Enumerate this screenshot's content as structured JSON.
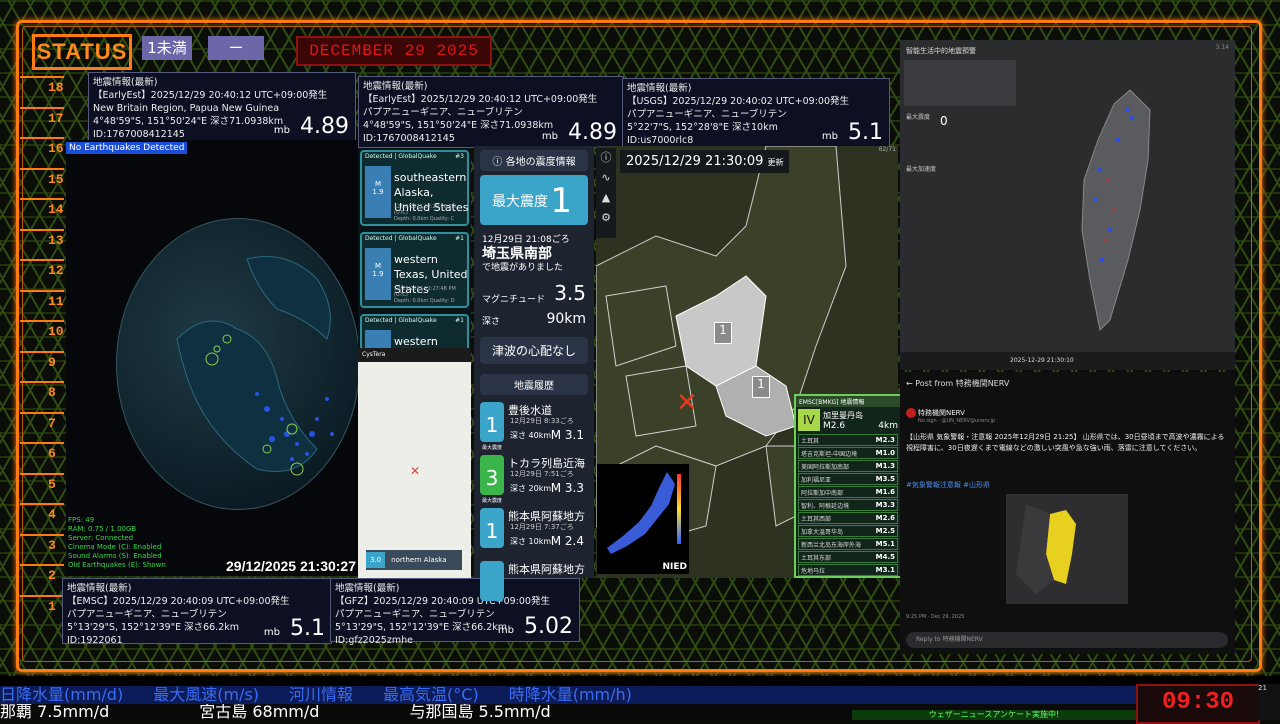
{
  "status_label": "STATUS",
  "pill1": "1未満",
  "pill2": "ー",
  "date_display": "DECEMBER 29  2025",
  "scale_numbers": [
    "18",
    "17",
    "16",
    "15",
    "14",
    "13",
    "12",
    "11",
    "10",
    "9",
    "8",
    "7",
    "6",
    "5",
    "4",
    "3",
    "2",
    "1"
  ],
  "cards": {
    "c1": {
      "title": "地震情報(最新)",
      "line1": "【EarlyEst】2025/12/29  20:40:12  UTC+09:00発生",
      "line2": "New Britain Region, Papua New Guinea",
      "line3": "4°48'59\"S,  151°50'24\"E  深さ71.0938km",
      "line4": "ID:1767008412145",
      "mb": "mb",
      "mag": "4.89"
    },
    "c2": {
      "title": "地震情報(最新)",
      "line1": "【EarlyEst】2025/12/29  20:40:12  UTC+09:00発生",
      "line2": "パプアニューギニア、ニューブリテン",
      "line3": "4°48'59\"S,  151°50'24\"E  深さ71.0938km",
      "line4": "ID:1767008412145",
      "mb": "mb",
      "mag": "4.89"
    },
    "c3": {
      "title": "地震情報(最新)",
      "line1": "【USGS】2025/12/29  20:40:02  UTC+09:00発生",
      "line2": "パプアニューギニア、ニューブリテン",
      "line3": "5°22'7\"S,  152°28'8\"E  深さ10km",
      "line4": "ID:us7000rlc8",
      "mb": "mb",
      "mag": "5.1"
    },
    "c4": {
      "title": "地震情報(最新)",
      "line1": "【EMSC】2025/12/29  20:40:09  UTC+09:00発生",
      "line2": "パプアニューギニア、ニューブリテン",
      "line3": "5°13'29\"S,  152°12'39\"E  深さ66.2km",
      "line4": "ID:1922061",
      "mb": "mb",
      "mag": "5.1"
    },
    "c5": {
      "title": "地震情報(最新)",
      "line1": "【GFZ】2025/12/29  20:40:09  UTC+09:00発生",
      "line2": "パプアニューギニア、ニューブリテン",
      "line3": "5°13'29\"S,  152°12'39\"E  深さ66.2km",
      "line4": "ID:gfz2025zmhe",
      "mb": "mb",
      "mag": "5.02"
    }
  },
  "globe": {
    "header": "No Earthquakes Detected",
    "info": [
      "FPS: 49",
      "RAM: 0.75 / 1.00GB",
      "Server: Connected",
      "Cinema Mode (C): Enabled",
      "Sound Alarms (S): Enabled",
      "Old Earthquakes (E): Shown"
    ],
    "timestamp": "29/12/2025 21:30:27"
  },
  "globalquake": [
    {
      "tag": "Detected | GlobalQuake",
      "num": "#3",
      "mag_label": "M",
      "mag": "1.9",
      "place": "southeastern Alaska, United States",
      "time": "12/29/2025 12:29:26 PM (UTC)",
      "meta": "Depth: 0.0km   Quality: C"
    },
    {
      "tag": "Detected | GlobalQuake",
      "num": "#1",
      "mag_label": "M",
      "mag": "1.9",
      "place": "western Texas, United States",
      "time": "12/29/2025 12:27:48 PM (UTC)",
      "meta": "Depth: 0.0km   Quality: D"
    },
    {
      "tag": "Detected | GlobalQuake",
      "num": "#1",
      "mag_label": "",
      "mag": "",
      "place": "western Texas,",
      "time": "",
      "meta": ""
    }
  ],
  "cystera": {
    "title": "CysTera",
    "popup_place": "northern Alaska",
    "popup_mag": "3.0"
  },
  "shindo": {
    "header": "各地の震度情報",
    "max_label": "最大震度",
    "max_value": "1",
    "datetime": "12月29日 21:08ごろ",
    "region": "埼玉県南部",
    "note": "で地震がありました",
    "mag_label": "マグニチュード",
    "mag_value": "3.5",
    "depth_label": "深さ",
    "depth_value": "90km",
    "tsunami": "津波の心配なし",
    "history_title": "地震履歴",
    "history": [
      {
        "badge": "",
        "shindo": "1",
        "color": "#3aa4c9",
        "place": "豊後水道",
        "time": "12月29日 8:33ごろ",
        "depth": "深さ  40km",
        "mag": "M 3.1"
      },
      {
        "badge": "最大震度",
        "shindo": "3",
        "color": "#3ab54a",
        "place": "トカラ列島近海",
        "time": "12月29日 7:51ごろ",
        "depth": "深さ  20km",
        "mag": "M 3.3"
      },
      {
        "badge": "最大震度",
        "shindo": "1",
        "color": "#3aa4c9",
        "place": "熊本県阿蘇地方",
        "time": "12月29日 7:37ごろ",
        "depth": "深さ  10km",
        "mag": "M 2.4"
      },
      {
        "badge": "",
        "shindo": "",
        "color": "#3aa4c9",
        "place": "熊本県阿蘇地方",
        "time": "",
        "depth": "",
        "mag": ""
      }
    ]
  },
  "map": {
    "time": "2025/12/29  21:30:09",
    "update": "更新",
    "intensity_a": "1",
    "intensity_b": "1",
    "corner": "62/71"
  },
  "emsc": {
    "head": "EMSC[BMKG]  地震情報",
    "level": "IV",
    "place": "加里曼丹岛",
    "mag": "M2.6",
    "depth": "4km",
    "events": [
      {
        "name": "土耳其",
        "mag": "M2.3"
      },
      {
        "name": "塔吉克斯坦-中国边境",
        "mag": "M1.0"
      },
      {
        "name": "美国阿拉斯加南部",
        "mag": "M1.3"
      },
      {
        "name": "加利福尼亚",
        "mag": "M3.5"
      },
      {
        "name": "阿拉斯加中南部",
        "mag": "M1.6"
      },
      {
        "name": "智利、阿根廷边境",
        "mag": "M3.3"
      },
      {
        "name": "土耳其西部",
        "mag": "M2.6"
      },
      {
        "name": "加拿大温哥华岛",
        "mag": "M2.5"
      },
      {
        "name": "新西兰北岛东海岸外海",
        "mag": "M5.1"
      },
      {
        "name": "土耳其东部",
        "mag": "M4.5"
      },
      {
        "name": "危地马拉",
        "mag": "M3.1"
      }
    ]
  },
  "nied": {
    "label": "NIED"
  },
  "taiwan": {
    "header": "智能生活中的地震預警",
    "max_label": "最大震度",
    "max_value": "0",
    "sub": "最大加速度",
    "bottom_time": "2025-12-29 21:30:10",
    "corner": "3.14"
  },
  "post": {
    "header": "Post from 特務機関NERV",
    "name": "特務機関NERV",
    "handle": "No sign · @UN_NERV@unerv.jp",
    "text": "【山形県 気象警報・注意報 2025年12月29日 21:25】\n山形県では、30日昼頃まで高波や濃霧による視程障害に、30日夜遅くまで電線などの激しい突風や急な強い雨、落雷に注意してください。",
    "tags": "#気象警報注意報  #山形県",
    "footer": "9:25 PM · Dec 29, 2025",
    "reply": "Reply to 特務機関NERV"
  },
  "ticker1": [
    "日降水量(mm/d)",
    "最大風速(m/s)",
    "河川情報",
    "最高気温(°C)",
    "時降水量(mm/h)"
  ],
  "ticker2": [
    "那覇  7.5mm/d",
    "宮古島  68mm/d",
    "与那国島  5.5mm/d"
  ],
  "ticker_green": "ウェザーニュースアンケート実施中!",
  "clock": "09:30",
  "clock_side": "21"
}
